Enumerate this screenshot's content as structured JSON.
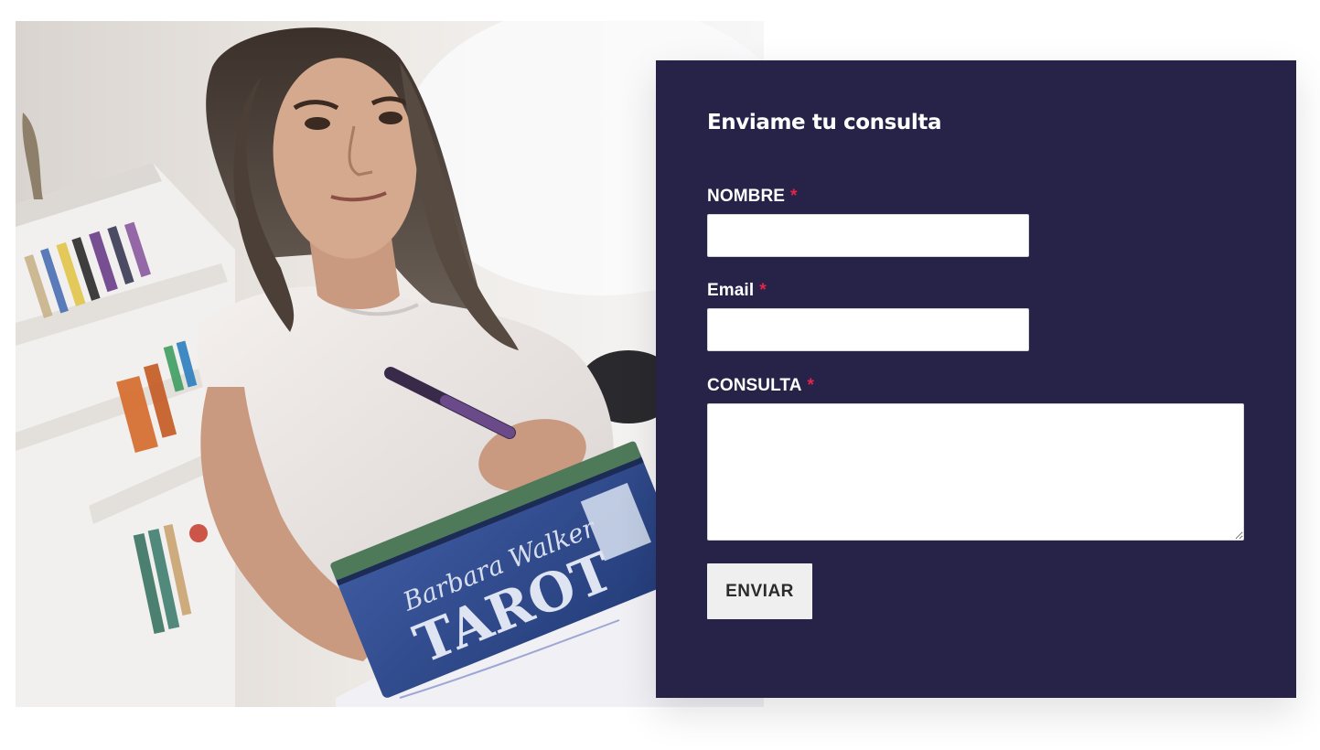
{
  "photo": {
    "icon": "tarot-reader-photo",
    "box_text_line1": "Barbara Walker",
    "box_text_line2": "TAROT"
  },
  "form": {
    "title": "Enviame tu consulta",
    "fields": [
      {
        "label": "NOMBRE",
        "required_mark": "*",
        "value": "",
        "placeholder": ""
      },
      {
        "label": "Email",
        "required_mark": "*",
        "value": "",
        "placeholder": ""
      },
      {
        "label": "CONSULTA",
        "required_mark": "*",
        "value": "",
        "placeholder": ""
      }
    ],
    "submit_label": "ENVIAR"
  },
  "colors": {
    "panel_bg": "#262248",
    "required": "#e5244a",
    "button_bg": "#efefef"
  }
}
